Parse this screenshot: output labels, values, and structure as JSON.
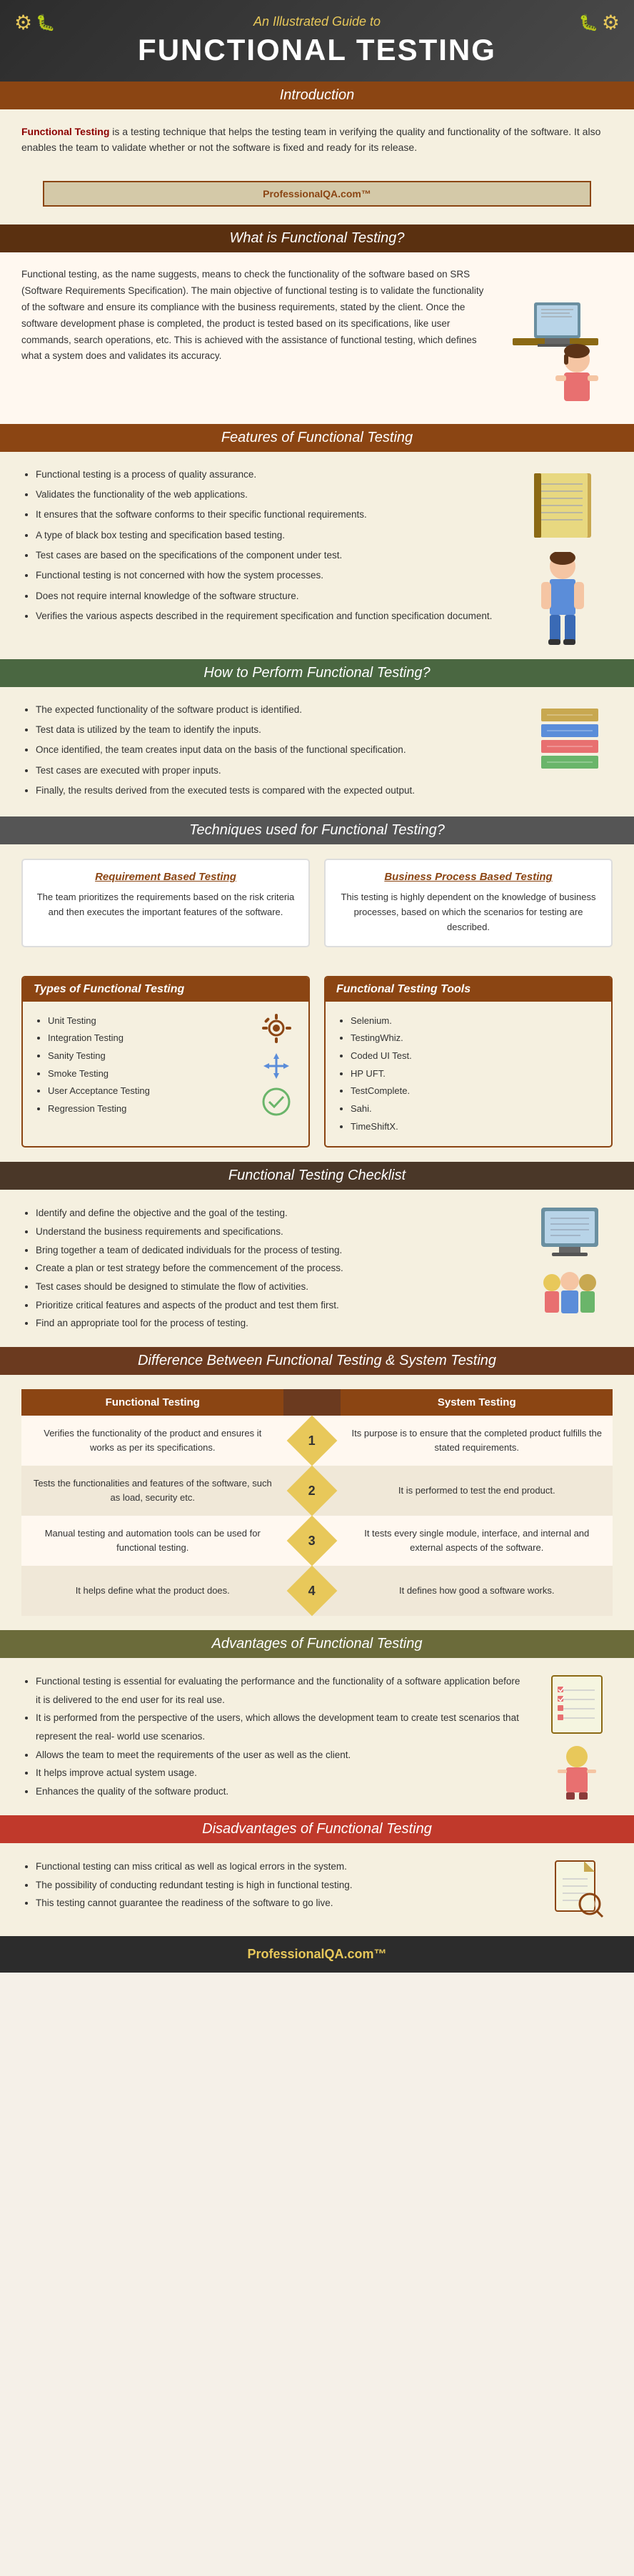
{
  "header": {
    "subtitle": "An Illustrated Guide to",
    "title": "FUNCTIONAL TESTING",
    "gear_icon_left": "⚙",
    "gear_icon_right": "⚙",
    "bug_icon": "🐛"
  },
  "intro": {
    "section_label": "Introduction",
    "text_bold": "Functional Testing",
    "text_rest": " is a testing technique that helps the testing team in verifying the quality and functionality of the software. It also enables the team to validate whether or not the software is fixed and ready for its release."
  },
  "professionalqa": {
    "text": "ProfessionalQA.com™"
  },
  "what_is": {
    "section_label": "What is Functional Testing?",
    "text": "Functional testing, as the name suggests, means to check the functionality of the software based on SRS (Software Requirements Specification). The main objective of functional testing is to validate the functionality of the software and ensure its compliance with the business requirements, stated by the client. Once the software development phase is completed, the product is tested based on its specifications, like user commands, search operations, etc. This is achieved with the assistance of functional testing, which defines what a system does and validates its accuracy."
  },
  "features": {
    "section_label": "Features of Functional Testing",
    "items": [
      "Functional testing is a process of quality assurance.",
      "Validates the functionality of the web applications.",
      "It ensures that the software conforms to their specific functional requirements.",
      "A type of black box testing and specification based testing.",
      "Test cases are based on the specifications of the component under test.",
      "Functional testing is not concerned with how the system processes.",
      "Does not require internal knowledge of the software structure.",
      "Verifies the various aspects described in the requirement specification and function specification document."
    ]
  },
  "howto": {
    "section_label": "How to Perform Functional Testing?",
    "items": [
      "The expected functionality of the software product is identified.",
      "Test data is utilized by the team to identify the inputs.",
      "Once identified, the team creates input data on the basis of the functional specification.",
      "Test cases are executed with proper inputs.",
      "Finally, the results derived from the executed tests is compared with the expected output."
    ]
  },
  "techniques": {
    "section_label": "Techniques used for Functional Testing?",
    "cards": [
      {
        "title": "Requirement Based Testing",
        "text": "The team prioritizes the requirements based on the risk criteria and then executes the important features of the software."
      },
      {
        "title": "Business Process Based Testing",
        "text": "This testing is highly dependent on the knowledge of business processes, based on which the scenarios for testing are described."
      }
    ]
  },
  "types": {
    "section_label": "Types of Functional Testing",
    "items": [
      "Unit Testing",
      "Integration Testing",
      "Sanity Testing",
      "Smoke Testing",
      "User Acceptance Testing",
      "Regression Testing"
    ]
  },
  "tools": {
    "section_label": "Functional Testing Tools",
    "items": [
      "Selenium.",
      "TestingWhiz.",
      "Coded UI Test.",
      "HP UFT.",
      "TestComplete.",
      "Sahi.",
      "TimeShiftX."
    ]
  },
  "checklist": {
    "section_label": "Functional Testing Checklist",
    "items": [
      "Identify and define the objective and the goal of the testing.",
      "Understand the business requirements and specifications.",
      "Bring together a team of dedicated individuals for the process of testing.",
      "Create a plan or test strategy before the commencement of the process.",
      "Test cases should be designed to stimulate the flow of activities.",
      "Prioritize critical features and aspects of the product and test them first.",
      "Find an appropriate tool for the process of testing."
    ]
  },
  "difference": {
    "section_label": "Difference Between Functional Testing & System Testing",
    "col1": "Functional Testing",
    "col2": "System Testing",
    "rows": [
      {
        "num": "1",
        "left": "Verifies the functionality of the product and ensures it works as per its specifications.",
        "right": "Its purpose is to ensure that the completed product fulfills the stated requirements."
      },
      {
        "num": "2",
        "left": "Tests the functionalities and features of the software, such as load, security etc.",
        "right": "It is performed to test the end product."
      },
      {
        "num": "3",
        "left": "Manual testing and automation tools can be used for functional testing.",
        "right": "It tests every single module, interface, and internal and external aspects of the software."
      },
      {
        "num": "4",
        "left": "It helps define what the product does.",
        "right": "It defines how good a software works."
      }
    ]
  },
  "advantages": {
    "section_label": "Advantages of Functional Testing",
    "items": [
      "Functional testing is essential for evaluating the performance and the functionality of a software application before it is delivered to the end user for its real use.",
      "It is performed from the perspective of the users, which allows the development team to create test scenarios that represent the real- world use scenarios.",
      "Allows the team to meet the requirements of the user as well as the client.",
      "It helps improve actual system usage.",
      "Enhances the quality of the software product."
    ]
  },
  "disadvantages": {
    "section_label": "Disadvantages of Functional Testing",
    "items": [
      "Functional testing can miss critical as well as logical errors in the system.",
      "The possibility of conducting redundant testing is high in functional testing.",
      "This testing cannot guarantee the readiness of the software to go live."
    ]
  },
  "footer": {
    "logo": "ProfessionalQA.com™"
  }
}
